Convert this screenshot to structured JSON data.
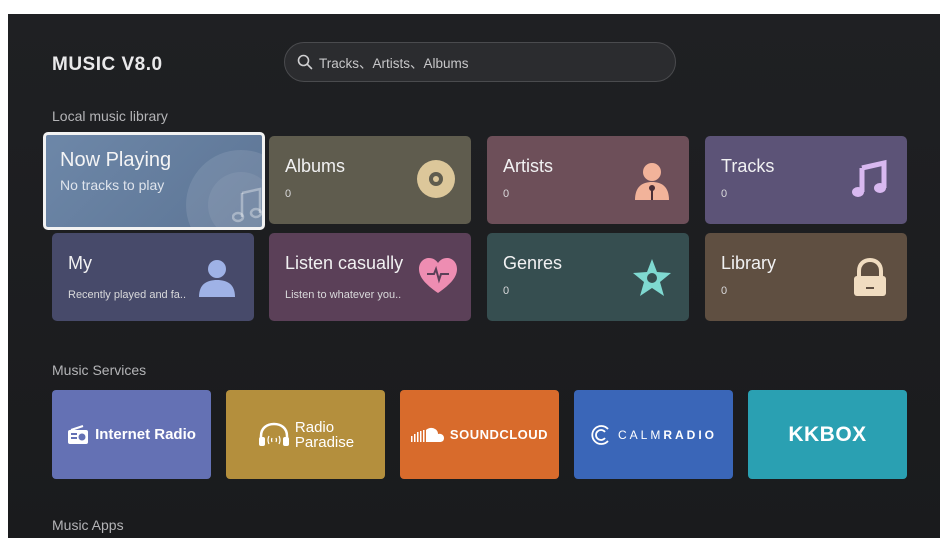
{
  "app": {
    "title": "MUSIC V8.0"
  },
  "search": {
    "placeholder": "Tracks、Artists、Albums"
  },
  "sections": {
    "local": "Local music library",
    "services": "Music Services",
    "apps": "Music Apps"
  },
  "local_tiles": [
    {
      "title": "Now Playing",
      "subtitle": "No tracks to play",
      "icon": "music-note-icon",
      "color": "#6d87a8"
    },
    {
      "title": "Albums",
      "subtitle": "0",
      "icon": "disc-icon",
      "color": "#5f5c4e"
    },
    {
      "title": "Artists",
      "subtitle": "0",
      "icon": "singer-icon",
      "color": "#6d4f59"
    },
    {
      "title": "Tracks",
      "subtitle": "0",
      "icon": "music-note-icon",
      "color": "#5c5377"
    },
    {
      "title": "My",
      "subtitle": "Recently played and fa..",
      "icon": "user-icon",
      "color": "#474a6a"
    },
    {
      "title": "Listen casually",
      "subtitle": "Listen to whatever you..",
      "icon": "heart-icon",
      "color": "#5b4058"
    },
    {
      "title": "Genres",
      "subtitle": "0",
      "icon": "star-icon",
      "color": "#364e50"
    },
    {
      "title": "Library",
      "subtitle": "0",
      "icon": "lock-icon",
      "color": "#5f4f41"
    }
  ],
  "services": [
    {
      "label": "Internet Radio",
      "icon": "radio-icon",
      "color": "#6471b4"
    },
    {
      "label": "Radio Paradise",
      "line1": "Radio",
      "line2": "Paradise",
      "icon": "headphones-icon",
      "color": "#b48f3d"
    },
    {
      "label": "SOUNDCLOUD",
      "icon": "soundcloud-icon",
      "color": "#d86b2c"
    },
    {
      "label": "CALMRADIO",
      "line1": "CALM",
      "line2": "RADIO",
      "icon": "calm-c-icon",
      "color": "#3a66b8"
    },
    {
      "label": "KKBOX",
      "icon": "",
      "color": "#2aa0b2"
    }
  ]
}
